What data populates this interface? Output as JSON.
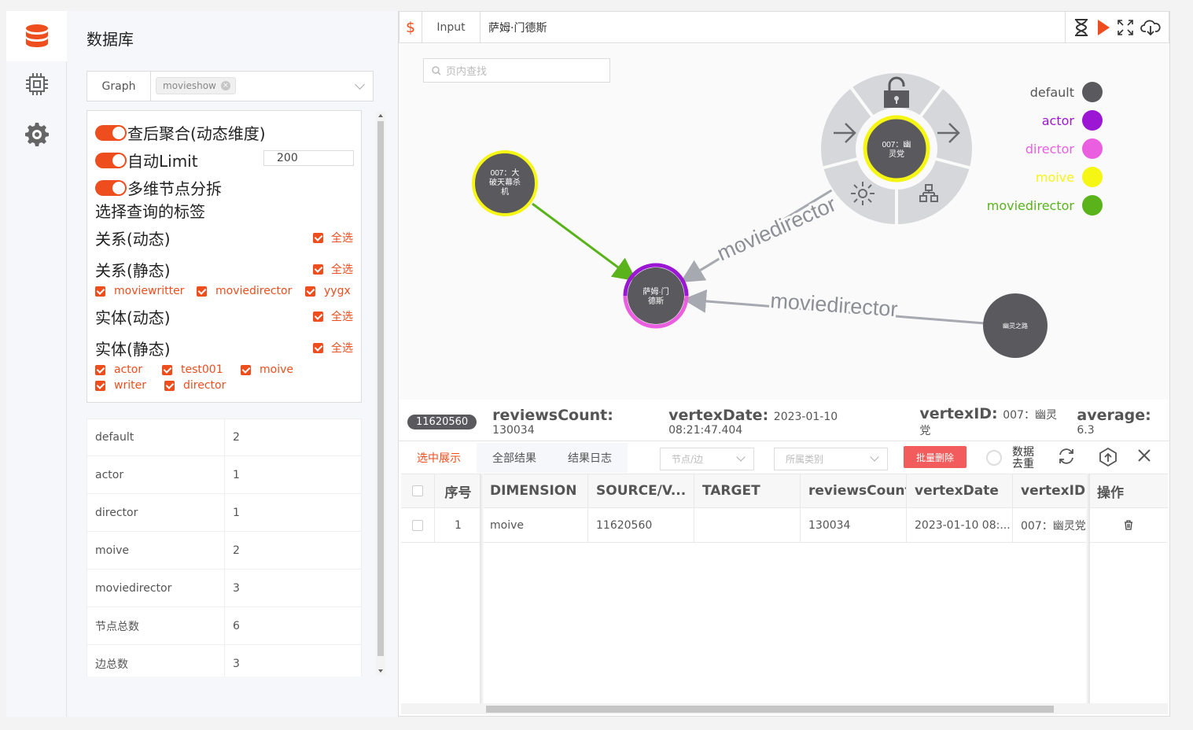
{
  "panel": {
    "title": "数据库"
  },
  "graph": {
    "label": "Graph",
    "tag": "movieshow"
  },
  "options": {
    "toggle1": "查后聚合(动态维度)",
    "toggle2": "自动Limit",
    "limit_value": "200",
    "toggle3": "多维节点分拆",
    "query_label_title": "选择查询的标签",
    "rel_dynamic": "关系(动态)",
    "rel_static": "关系(静态)",
    "ent_dynamic": "实体(动态)",
    "ent_static": "实体(静态)",
    "select_all": "全选",
    "rel_static_items": [
      "moviewritter",
      "moviedirector",
      "yygx"
    ],
    "ent_static_items": [
      "actor",
      "test001",
      "moive",
      "writer",
      "director"
    ]
  },
  "counts": [
    {
      "k": "default",
      "v": "2"
    },
    {
      "k": "actor",
      "v": "1"
    },
    {
      "k": "director",
      "v": "1"
    },
    {
      "k": "moive",
      "v": "2"
    },
    {
      "k": "moviedirector",
      "v": "3"
    },
    {
      "k": "节点总数",
      "v": "6"
    },
    {
      "k": "边总数",
      "v": "3"
    }
  ],
  "query": {
    "dollar": "$",
    "tab": "Input",
    "text": "萨姆·门德斯"
  },
  "canvas": {
    "find_placeholder": "页内查找",
    "node_a": [
      "007：大",
      "破天幕杀",
      "机"
    ],
    "node_center": [
      "萨姆·门",
      "德斯"
    ],
    "node_menu": [
      "007：幽",
      "灵党"
    ],
    "node_right": "幽灵之路",
    "edge_label": "moviedirector"
  },
  "legend": [
    {
      "name": "default",
      "color": "#5a5a5e"
    },
    {
      "name": "actor",
      "color": "#9b17d3"
    },
    {
      "name": "director",
      "color": "#ea5fe0"
    },
    {
      "name": "moive",
      "color": "#f6f615"
    },
    {
      "name": "moviedirector",
      "color": "#5bb31c"
    }
  ],
  "detail": {
    "id": "11620560",
    "k1": "reviewsCount",
    "v1": "130034",
    "k2": "vertexDate",
    "v2": "2023-01-10 08:21:47.404",
    "k3": "vertexID",
    "v3": "007：幽灵党",
    "k4": "average",
    "v4": "6.3"
  },
  "result": {
    "tabs": [
      "选中展示",
      "全部结果",
      "结果日志"
    ],
    "sel1": "节点/边",
    "sel2": "所属类别",
    "delete_btn": "批量删除",
    "dedup": "数据去重",
    "headers": [
      "序号",
      "DIMENSION",
      "SOURCE/V...",
      "TARGET",
      "reviewsCount",
      "vertexDate",
      "vertexID",
      "操作"
    ],
    "row": [
      "1",
      "moive",
      "11620560",
      "",
      "130034",
      "2023-01-10 08:...",
      "007：幽灵党"
    ]
  }
}
